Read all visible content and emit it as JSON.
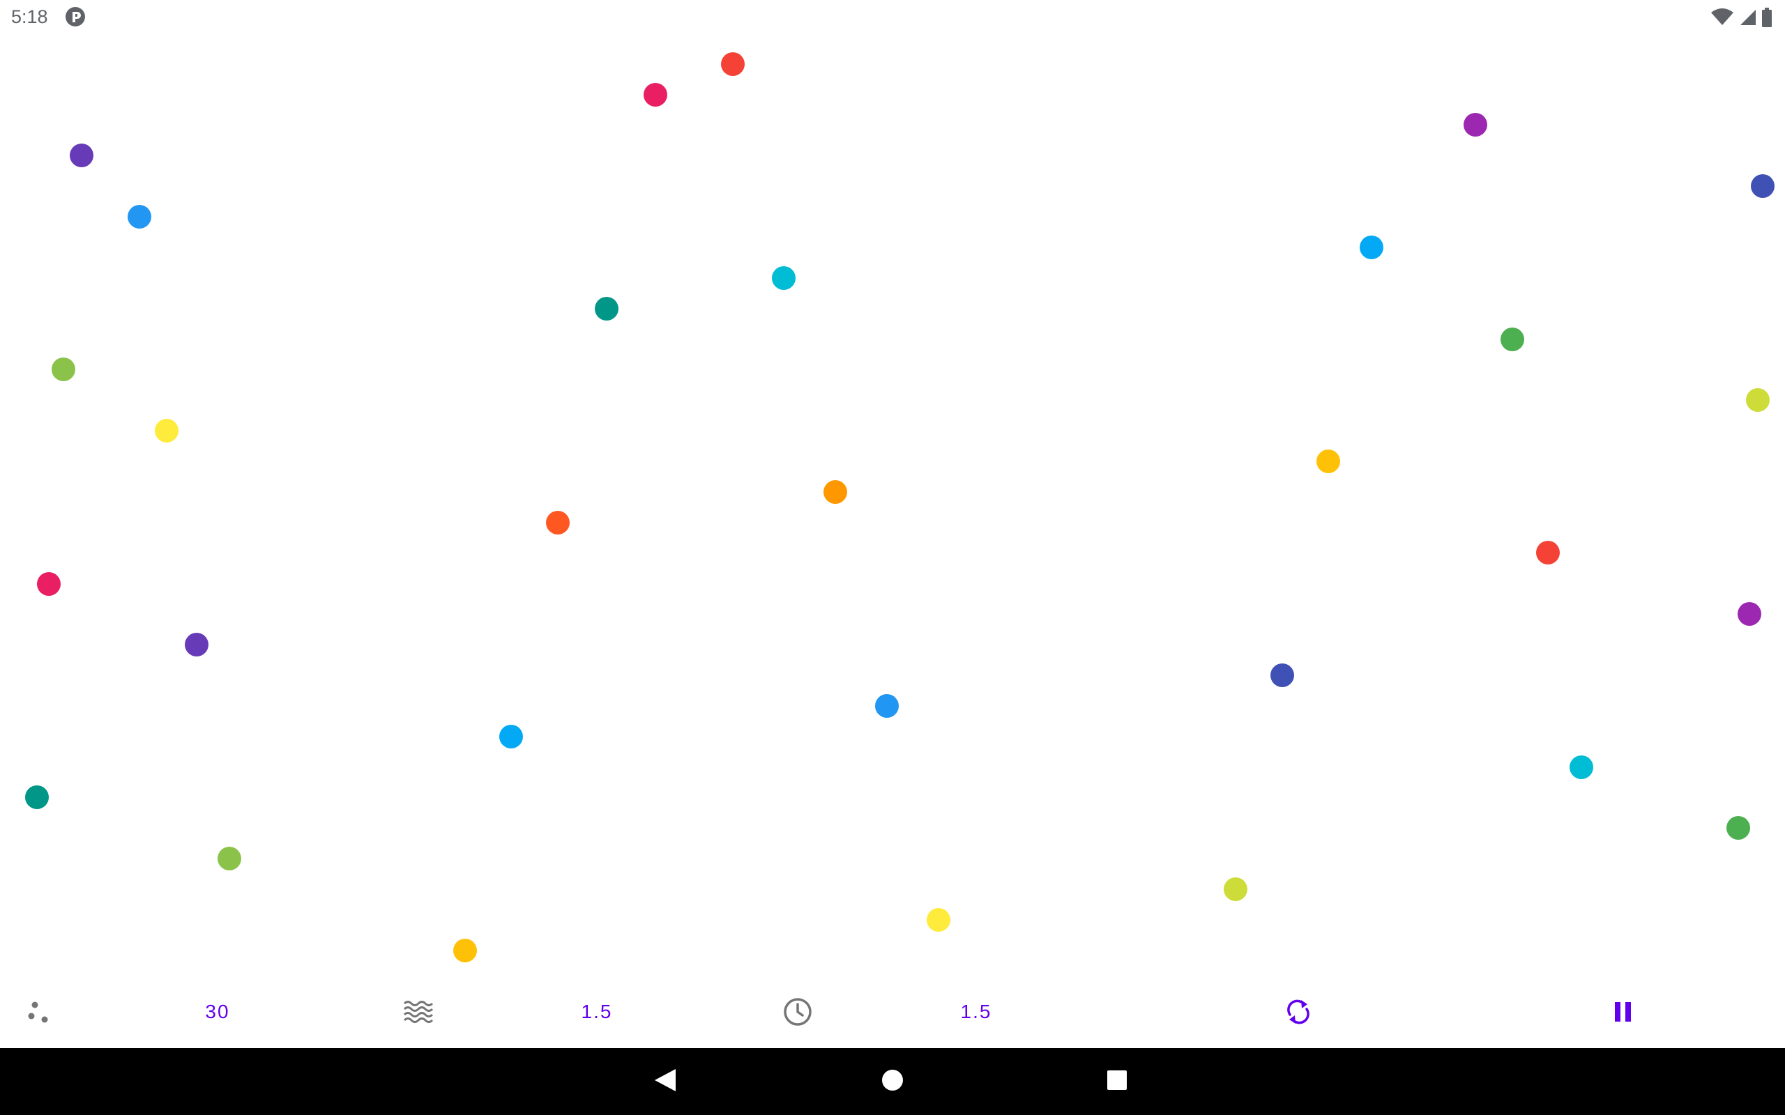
{
  "status_bar": {
    "time": "5:18",
    "app_icon": "pocket-casts-style-icon",
    "wifi_icon": "wifi-icon",
    "signal_icon": "cell-signal-icon",
    "battery_icon": "battery-icon"
  },
  "particles": [
    {
      "color": "#673ab7"
    },
    {
      "color": "#2196f3"
    },
    {
      "color": "#8bc34a"
    },
    {
      "color": "#ffeb3b"
    },
    {
      "color": "#e91e63"
    },
    {
      "color": "#673ab7"
    },
    {
      "color": "#009688"
    },
    {
      "color": "#8bc34a"
    },
    {
      "color": "#ffc107"
    },
    {
      "color": "#03a9f4"
    },
    {
      "color": "#ff5722"
    },
    {
      "color": "#009688"
    },
    {
      "color": "#e91e63"
    },
    {
      "color": "#f44336"
    },
    {
      "color": "#00bcd4"
    },
    {
      "color": "#ff9800"
    },
    {
      "color": "#2196f3"
    },
    {
      "color": "#ffeb3b"
    },
    {
      "color": "#cddc39"
    },
    {
      "color": "#3f51b5"
    },
    {
      "color": "#ffc107"
    },
    {
      "color": "#03a9f4"
    },
    {
      "color": "#9c27b0"
    },
    {
      "color": "#4caf50"
    },
    {
      "color": "#f44336"
    },
    {
      "color": "#00bcd4"
    },
    {
      "color": "#3f51b5"
    },
    {
      "color": "#cddc39"
    },
    {
      "color": "#9c27b0"
    },
    {
      "color": "#4caf50"
    }
  ],
  "controls": {
    "particles_icon": "scatter-dots-icon",
    "particle_count": "30",
    "waves_icon": "waves-icon",
    "wave_value": "1.5",
    "clock_icon": "clock-icon",
    "speed_value": "1.5",
    "refresh_icon": "refresh-icon",
    "pause_icon": "pause-icon",
    "accent_color": "#6200ee",
    "icon_gray": "#757575"
  },
  "nav_bar": {
    "back_icon": "back-triangle-icon",
    "home_icon": "home-circle-icon",
    "recents_icon": "recents-square-icon"
  }
}
